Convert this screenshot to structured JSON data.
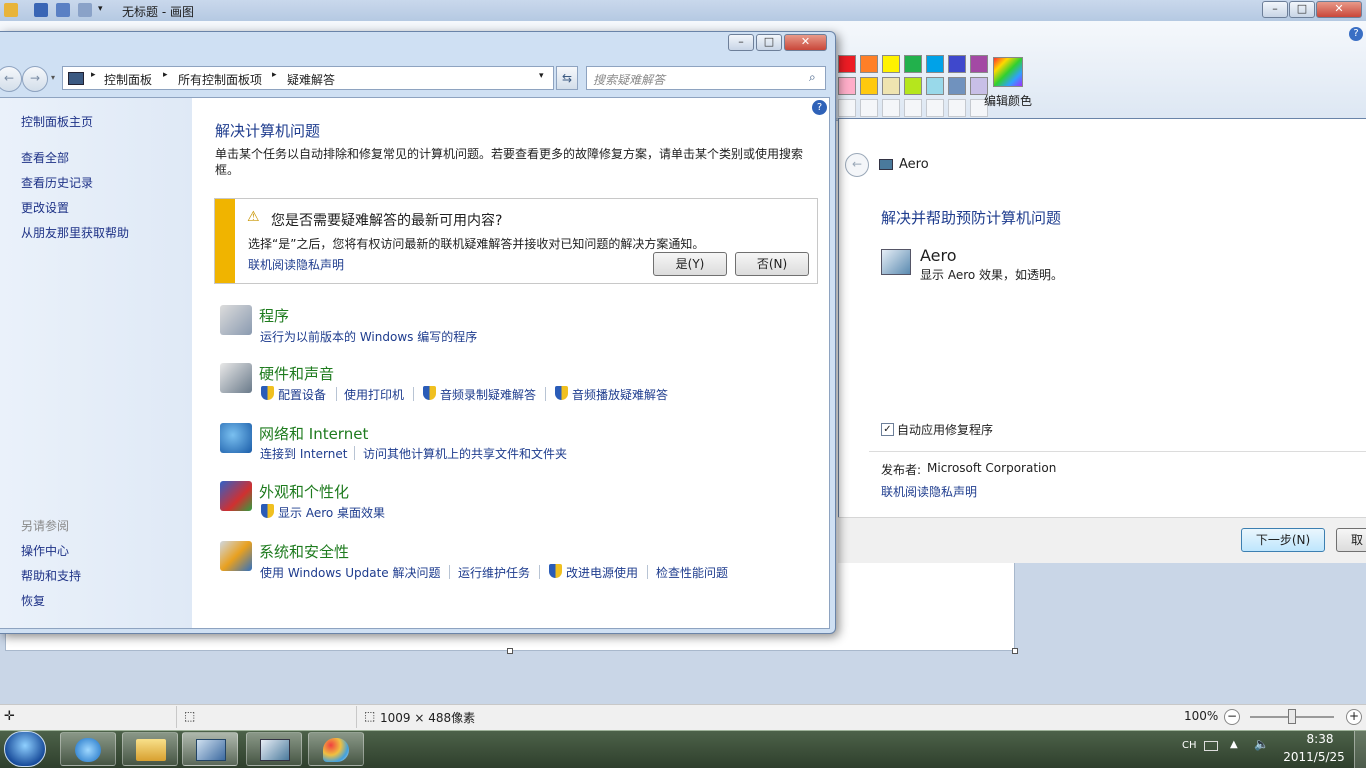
{
  "paint": {
    "title": "无标题 - 画图",
    "edit_colors_label": "编辑颜色",
    "status_size": "1009 × 488像素",
    "zoom": "100%",
    "palette_row1": [
      "#ed1c24",
      "#ff7f27",
      "#fff200",
      "#22b14c",
      "#00a2e8",
      "#3f48cc",
      "#a349a4"
    ],
    "palette_row2": [
      "#ffaec9",
      "#ffc90e",
      "#efe4b0",
      "#b5e61d",
      "#99d9ea",
      "#7092be",
      "#c8bfe7"
    ],
    "help_glyph": "?"
  },
  "control_panel": {
    "breadcrumb": [
      "控制面板",
      "所有控制面板项",
      "疑难解答"
    ],
    "search_placeholder": "搜索疑难解答",
    "nav_links": [
      "控制面板主页",
      "查看全部",
      "查看历史记录",
      "更改设置",
      "从朋友那里获取帮助"
    ],
    "see_also_heading": "另请参阅",
    "see_also_links": [
      "操作中心",
      "帮助和支持",
      "恢复"
    ],
    "heading": "解决计算机问题",
    "description": "单击某个任务以自动排除和修复常见的计算机问题。若要查看更多的故障修复方案，请单击某个类别或使用搜索框。",
    "banner": {
      "title": "您是否需要疑难解答的最新可用内容?",
      "body": "选择“是”之后，您将有权访问最新的联机疑难解答并接收对已知问题的解决方案通知。",
      "privacy_link": "联机阅读隐私声明",
      "yes_button": "是(Y)",
      "no_button": "否(N)"
    },
    "categories": [
      {
        "title": "程序",
        "links": [
          "运行为以前版本的 Windows 编写的程序"
        ]
      },
      {
        "title": "硬件和声音",
        "links": [
          "配置设备",
          "使用打印机",
          "音频录制疑难解答",
          "音频播放疑难解答"
        ]
      },
      {
        "title": "网络和 Internet",
        "links": [
          "连接到 Internet",
          "访问其他计算机上的共享文件和文件夹"
        ]
      },
      {
        "title": "外观和个性化",
        "links": [
          "显示 Aero 桌面效果"
        ]
      },
      {
        "title": "系统和安全性",
        "links": [
          "使用 Windows Update 解决问题",
          "运行维护任务",
          "改进电源使用",
          "检查性能问题"
        ]
      }
    ]
  },
  "aero_dialog": {
    "window_title": "Aero",
    "heading": "解决并帮助预防计算机问题",
    "item_title": "Aero",
    "item_desc": "显示 Aero 效果，如透明。",
    "auto_repair_label": "自动应用修复程序",
    "auto_repair_checked": true,
    "publisher_label": "发布者:",
    "publisher_value": "Microsoft Corporation",
    "privacy_link": "联机阅读隐私声明",
    "next_button": "下一步(N)",
    "cancel_button": "取"
  },
  "taskbar": {
    "ime": "CH",
    "time": "8:38",
    "date": "2011/5/25"
  }
}
